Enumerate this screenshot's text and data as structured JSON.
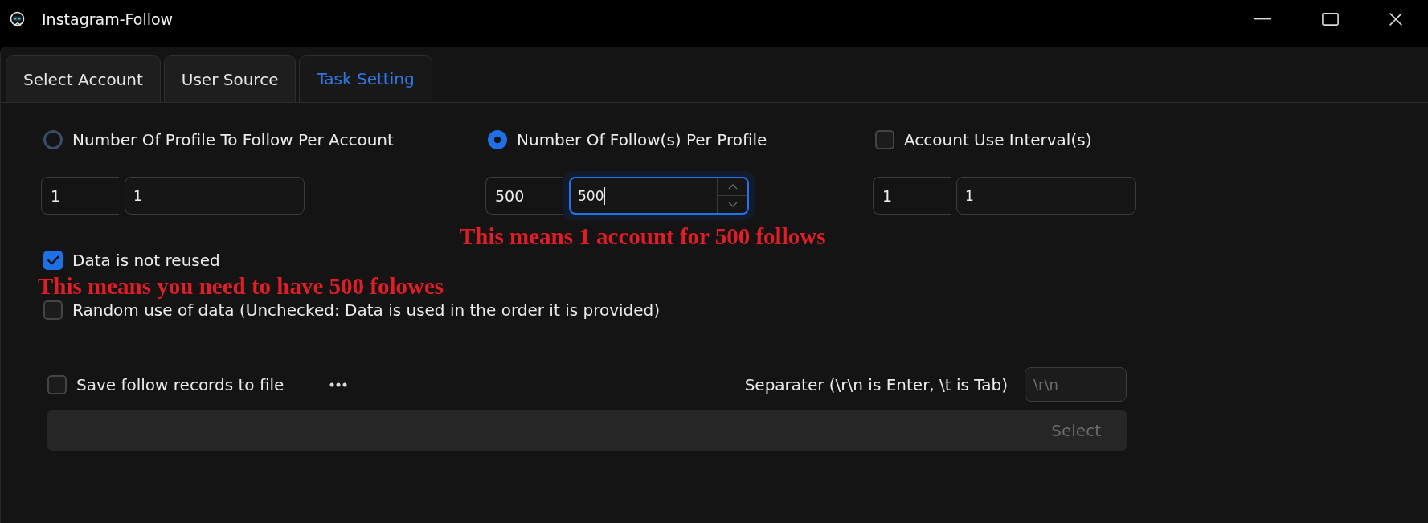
{
  "window": {
    "title": "Instagram-Follow"
  },
  "tabs": [
    {
      "label": "Select Account",
      "selected": false
    },
    {
      "label": "User Source",
      "selected": false
    },
    {
      "label": "Task Setting",
      "selected": true
    }
  ],
  "follow_modes": [
    {
      "label": "Number Of Profile To Follow Per Account",
      "selected": false,
      "display": "1",
      "value": "1",
      "focused": false
    },
    {
      "label": "Number Of Follow(s) Per Profile",
      "selected": true,
      "display": "500",
      "value": "500",
      "focused": true,
      "annotation": "This means 1 account for 500 follows"
    }
  ],
  "interval": {
    "label": "Account Use Interval(s)",
    "checked": false,
    "display": "1",
    "value": "1",
    "focused": false
  },
  "data_options": [
    {
      "label": "Data is not reused",
      "checked": true,
      "annotation": "This means you need to have 500 folowes"
    },
    {
      "label": "Random use of data (Unchecked: Data is used in the order it is provided)",
      "checked": false
    }
  ],
  "save_records": {
    "label": "Save follow records to file",
    "checked": false
  },
  "separator": {
    "label": "Separater (\\r\\n is Enter, \\t is Tab)",
    "placeholder": "\\r\\n"
  },
  "file_path": {
    "button": "Select",
    "disabled": true
  }
}
